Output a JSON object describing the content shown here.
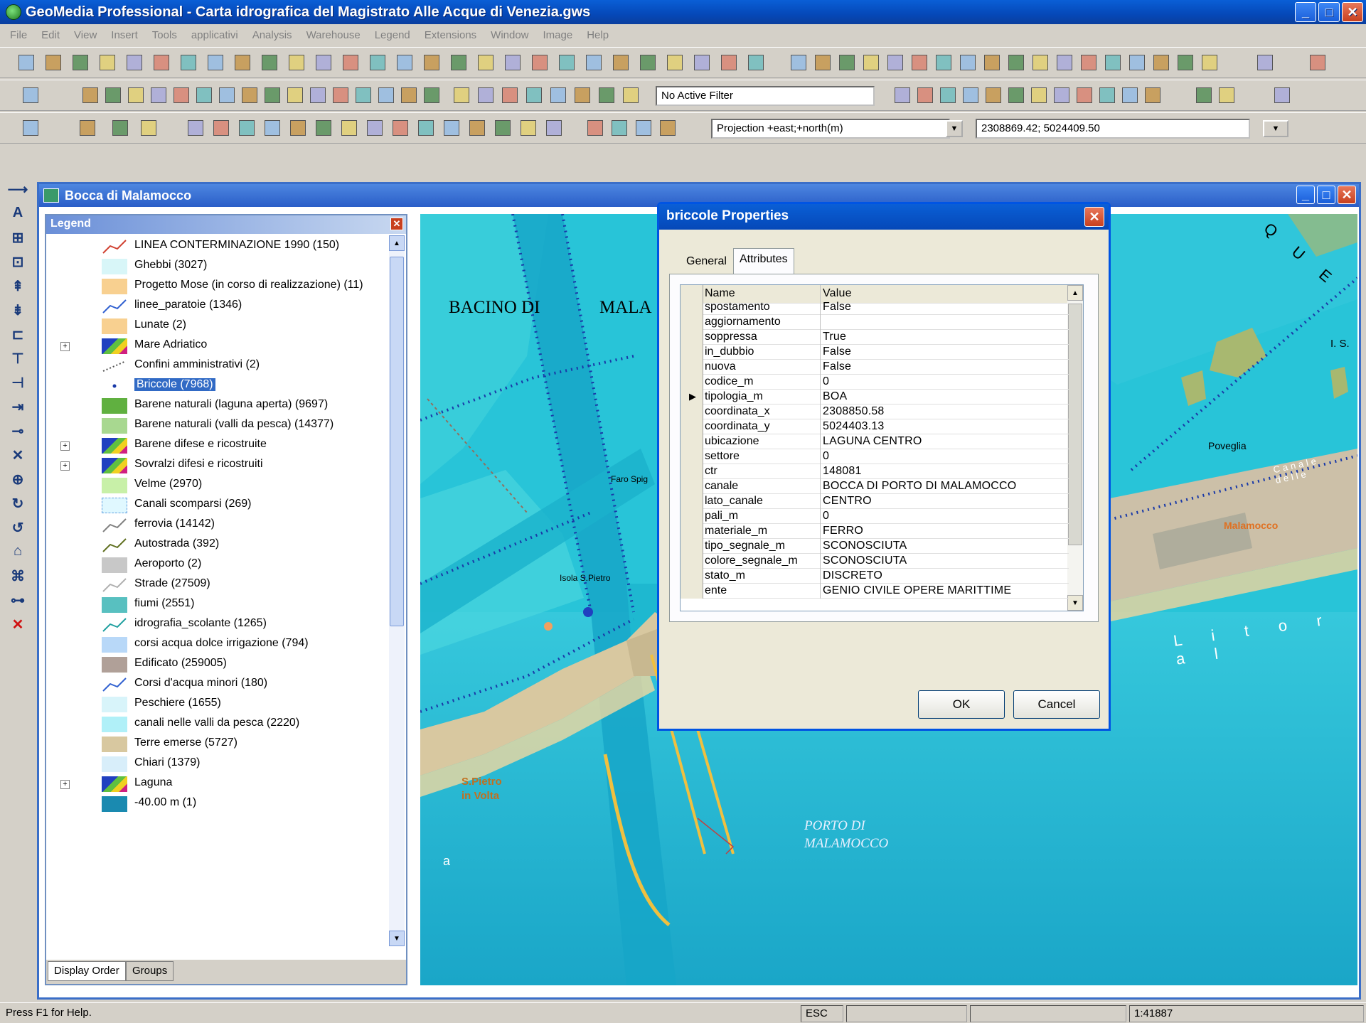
{
  "app": {
    "title": "GeoMedia Professional - Carta idrografica del Magistrato Alle Acque di Venezia.gws"
  },
  "menu": [
    "File",
    "Edit",
    "View",
    "Insert",
    "Tools",
    "applicativi",
    "Analysis",
    "Warehouse",
    "Legend",
    "Extensions",
    "Window",
    "Image",
    "Help"
  ],
  "toolbar": {
    "filter_value": "No Active Filter",
    "projection_value": "Projection +east;+north(m)",
    "coordinates_value": "2308869.42; 5024409.50"
  },
  "map_window": {
    "title": "Bocca di Malamocco"
  },
  "legend": {
    "title": "Legend",
    "tabs": [
      "Display Order",
      "Groups"
    ],
    "items": [
      {
        "label": "LINEA CONTERMINAZIONE 1990 (150)",
        "sym": "line-red"
      },
      {
        "label": "Ghebbi (3027)",
        "sym": "fill-lightcyan"
      },
      {
        "label": "Progetto Mose (in corso di realizzazione) (11)",
        "sym": "fill-orange"
      },
      {
        "label": "linee_paratoie (1346)",
        "sym": "line-blue"
      },
      {
        "label": "Lunate (2)",
        "sym": "fill-orange"
      },
      {
        "label": "Mare Adriatico",
        "sym": "group",
        "expander": "+"
      },
      {
        "label": "Confini amministrativi (2)",
        "sym": "dotted"
      },
      {
        "label": "Briccole (7968)",
        "sym": "point",
        "selected": true
      },
      {
        "label": "Barene naturali (laguna aperta) (9697)",
        "sym": "fill-green"
      },
      {
        "label": "Barene naturali (valli da pesca) (14377)",
        "sym": "fill-lightgreen"
      },
      {
        "label": "Barene difese e ricostruite",
        "sym": "group",
        "expander": "+"
      },
      {
        "label": "Sovralzi difesi e ricostruiti",
        "sym": "group",
        "expander": "+"
      },
      {
        "label": "Velme (2970)",
        "sym": "fill-palegreen"
      },
      {
        "label": "Canali scomparsi (269)",
        "sym": "fill-dashed"
      },
      {
        "label": "ferrovia (14142)",
        "sym": "line-grey"
      },
      {
        "label": "Autostrada (392)",
        "sym": "line-olive"
      },
      {
        "label": "Aeroporto (2)",
        "sym": "fill-grey"
      },
      {
        "label": "Strade (27509)",
        "sym": "line-lightgrey"
      },
      {
        "label": "fiumi (2551)",
        "sym": "fill-teal"
      },
      {
        "label": "idrografia_scolante (1265)",
        "sym": "line-teal"
      },
      {
        "label": "corsi acqua dolce irrigazione (794)",
        "sym": "fill-skyblue"
      },
      {
        "label": "Edificato (259005)",
        "sym": "fill-brown"
      },
      {
        "label": "Corsi d'acqua minori (180)",
        "sym": "line-blue"
      },
      {
        "label": "Peschiere (1655)",
        "sym": "fill-paleblue"
      },
      {
        "label": "canali nelle valli da pesca (2220)",
        "sym": "fill-aqua"
      },
      {
        "label": "Terre emerse (5727)",
        "sym": "fill-tan"
      },
      {
        "label": "Chiari (1379)",
        "sym": "fill-paleblue2"
      },
      {
        "label": "Laguna",
        "sym": "group",
        "expander": "+"
      },
      {
        "label": "-40.00 m (1)",
        "sym": "fill-deepblue"
      }
    ]
  },
  "map_labels": {
    "bacino": "BACINO DI",
    "mala": "MALA",
    "fato": "Faro Spig",
    "isola": "Isola S.Pietro",
    "spietro1": "S.Pietro",
    "spietro2": "in Volta",
    "porto1": "PORTO DI",
    "porto2": "MALAMOCCO",
    "malamocco": "Malamocco",
    "poveglia": "Poveglia",
    "is": "I. S.",
    "a": "a",
    "litorale": "L i t o r a l",
    "acque": "C Q U E",
    "canale": "Canale delle"
  },
  "dialog": {
    "title": "briccole Properties",
    "tabs": [
      "General",
      "Attributes"
    ],
    "header": {
      "name": "Name",
      "value": "Value"
    },
    "rows": [
      {
        "name": "spostamento",
        "value": "False"
      },
      {
        "name": "aggiornamento",
        "value": ""
      },
      {
        "name": "soppressa",
        "value": "True"
      },
      {
        "name": "in_dubbio",
        "value": "False"
      },
      {
        "name": "nuova",
        "value": "False"
      },
      {
        "name": "codice_m",
        "value": "0"
      },
      {
        "name": "tipologia_m",
        "value": "BOA",
        "current": true
      },
      {
        "name": "coordinata_x",
        "value": "2308850.58"
      },
      {
        "name": "coordinata_y",
        "value": "5024403.13"
      },
      {
        "name": "ubicazione",
        "value": "LAGUNA CENTRO"
      },
      {
        "name": "settore",
        "value": "0"
      },
      {
        "name": "ctr",
        "value": "148081"
      },
      {
        "name": "canale",
        "value": "BOCCA DI PORTO DI MALAMOCCO"
      },
      {
        "name": "lato_canale",
        "value": "CENTRO"
      },
      {
        "name": "pali_m",
        "value": "0"
      },
      {
        "name": "materiale_m",
        "value": "FERRO"
      },
      {
        "name": "tipo_segnale_m",
        "value": "SCONOSCIUTA"
      },
      {
        "name": "colore_segnale_m",
        "value": "SCONOSCIUTA"
      },
      {
        "name": "stato_m",
        "value": "DISCRETO"
      },
      {
        "name": "ente",
        "value": "GENIO CIVILE OPERE MARITTIME"
      }
    ],
    "ok": "OK",
    "cancel": "Cancel"
  },
  "status": {
    "help": "Press F1 for Help.",
    "esc": "ESC",
    "scale": "1:41887"
  }
}
